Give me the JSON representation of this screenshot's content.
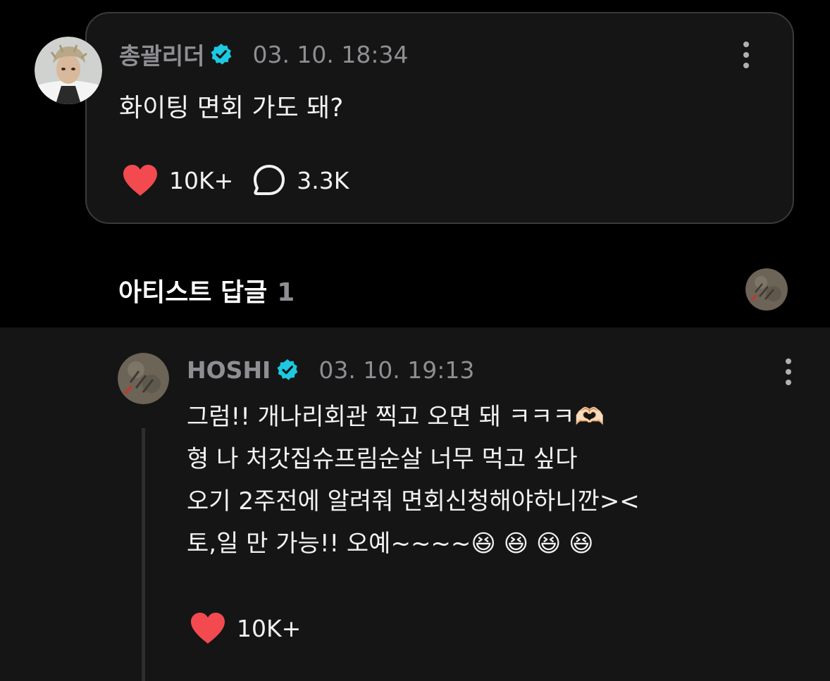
{
  "post": {
    "author": "총괄리더",
    "timestamp": "03. 10. 18:34",
    "text": "화이팅 면회 가도 돼?",
    "like_count": "10K+",
    "comment_count": "3.3K"
  },
  "artist_replies": {
    "title": "아티스트 답글",
    "count": "1"
  },
  "reply": {
    "author": "HOSHI",
    "timestamp": "03. 10. 19:13",
    "lines": [
      "그럼!! 개나리회관 찍고 오면 돼 ㅋㅋㅋ🫶🏻",
      "형 나 처갓집슈프림순살 너무 먹고 싶다",
      "오기 2주전에 알려줘 면회신청해야하니깐><",
      "토,일 만 가능!! 오예~~~~😆 😆 😆 😆"
    ],
    "like_count": "10K+"
  },
  "colors": {
    "background": "#000000",
    "card": "#151515",
    "verified": "#1ec8e0",
    "heart": "#f24a4f",
    "muted_text": "#8e8e93"
  },
  "icons": [
    "verified-icon",
    "more-options-icon",
    "heart-icon",
    "comment-bubble-icon"
  ]
}
